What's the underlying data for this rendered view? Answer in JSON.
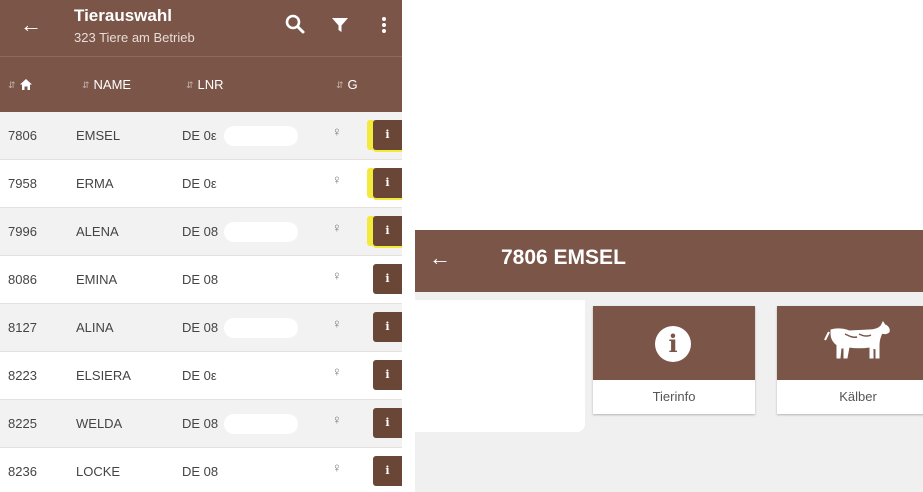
{
  "list_screen": {
    "appbar": {
      "back_icon": "arrow-left-icon",
      "title": "Tierauswahl",
      "subtitle": "323 Tiere am Betrieb",
      "actions": [
        "search-icon",
        "filter-icon",
        "more-vert-icon"
      ]
    },
    "columns": [
      {
        "key": "home",
        "label": "",
        "icon": "home-icon"
      },
      {
        "key": "name",
        "label": "NAME"
      },
      {
        "key": "lnr",
        "label": "LNR"
      },
      {
        "key": "g",
        "label": "G"
      }
    ],
    "rows": [
      {
        "number": "7806",
        "name": "EMSEL",
        "lnr": "DE 0ε",
        "sex": "♀",
        "info": "i",
        "highlighted": true
      },
      {
        "number": "7958",
        "name": "ERMA",
        "lnr": "DE 0ε",
        "sex": "♀",
        "info": "i",
        "highlighted": true
      },
      {
        "number": "7996",
        "name": "ALENA",
        "lnr": "DE 08",
        "sex": "♀",
        "info": "i",
        "highlighted": true
      },
      {
        "number": "8086",
        "name": "EMINA",
        "lnr": "DE 08",
        "sex": "♀",
        "info": "i",
        "highlighted": false
      },
      {
        "number": "8127",
        "name": "ALINA",
        "lnr": "DE 08",
        "sex": "♀",
        "info": "i",
        "highlighted": false
      },
      {
        "number": "8223",
        "name": "ELSIERA",
        "lnr": "DE 0ε",
        "sex": "♀",
        "info": "i",
        "highlighted": false
      },
      {
        "number": "8225",
        "name": "WELDA",
        "lnr": "DE 08",
        "sex": "♀",
        "info": "i",
        "highlighted": false
      },
      {
        "number": "8236",
        "name": "LOCKE",
        "lnr": "DE 08",
        "sex": "♀",
        "info": "i",
        "highlighted": false
      }
    ]
  },
  "detail_screen": {
    "back_icon": "arrow-left-icon",
    "title": "7806 EMSEL",
    "tiles": [
      {
        "label": "Tierinfo",
        "icon": "info-circle-icon",
        "icon_glyph": "i"
      },
      {
        "label": "Kälber",
        "icon": "calf-icon"
      }
    ]
  },
  "colors": {
    "primary": "#7a5548",
    "info_button": "#6a4636",
    "highlight": "#f2ea3c"
  }
}
